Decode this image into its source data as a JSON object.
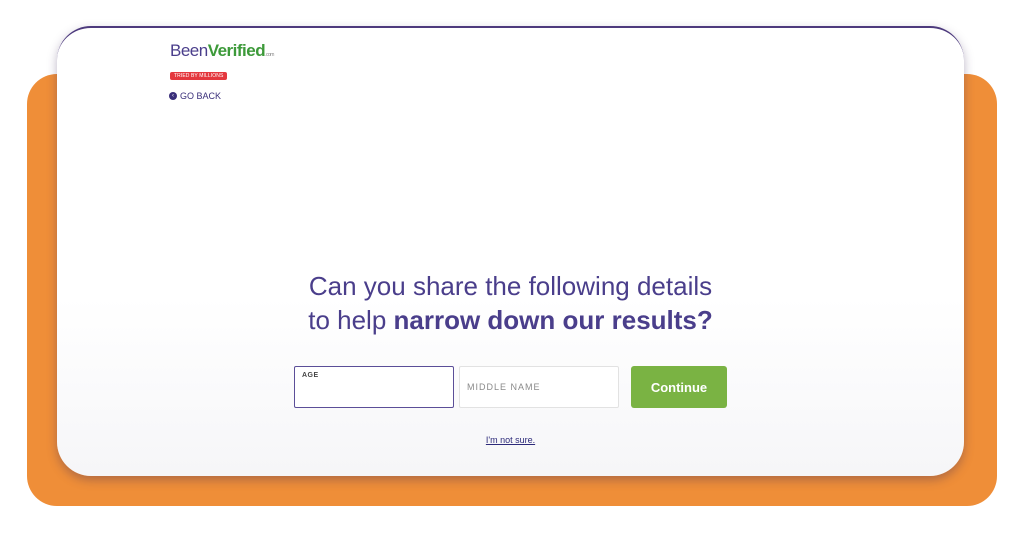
{
  "logo": {
    "been": "Been",
    "verified": "Verified",
    "com": ".com",
    "tagline": "TRIED BY MILLIONS"
  },
  "nav": {
    "go_back_label": "GO BACK",
    "go_back_icon": "chevron-left-circle-icon"
  },
  "headline": {
    "line1": "Can you share the following details",
    "line2_prefix": "to help ",
    "line2_bold": "narrow down our results?"
  },
  "form": {
    "age_label": "AGE",
    "age_value": "",
    "middle_name_placeholder": "MIDDLE NAME",
    "middle_name_value": "",
    "continue_label": "Continue"
  },
  "not_sure_link": "I'm not sure.",
  "colors": {
    "accent_purple": "#4a3e8b",
    "button_green": "#7ab343",
    "frame_orange": "#ef8e38",
    "tag_red": "#e4383e"
  }
}
